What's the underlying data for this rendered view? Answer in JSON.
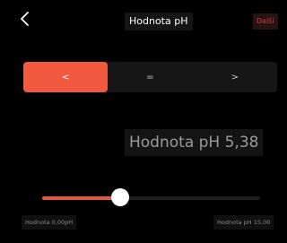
{
  "header": {
    "back_icon": "chevron-left-icon",
    "title": "Hodnota pH",
    "next_label": "Další"
  },
  "segmented": {
    "options": [
      "<",
      "=",
      ">"
    ],
    "selected_index": 0
  },
  "readout": {
    "text": "Hodnota pH 5,38"
  },
  "slider": {
    "min": 0,
    "max": 15,
    "value": 5.38,
    "min_label": "Hodnota 0,00pH",
    "max_label": "Hodnota pH 15,00"
  },
  "colors": {
    "accent": "#f05a3e",
    "background": "#000000",
    "next_text": "#c0453a"
  }
}
